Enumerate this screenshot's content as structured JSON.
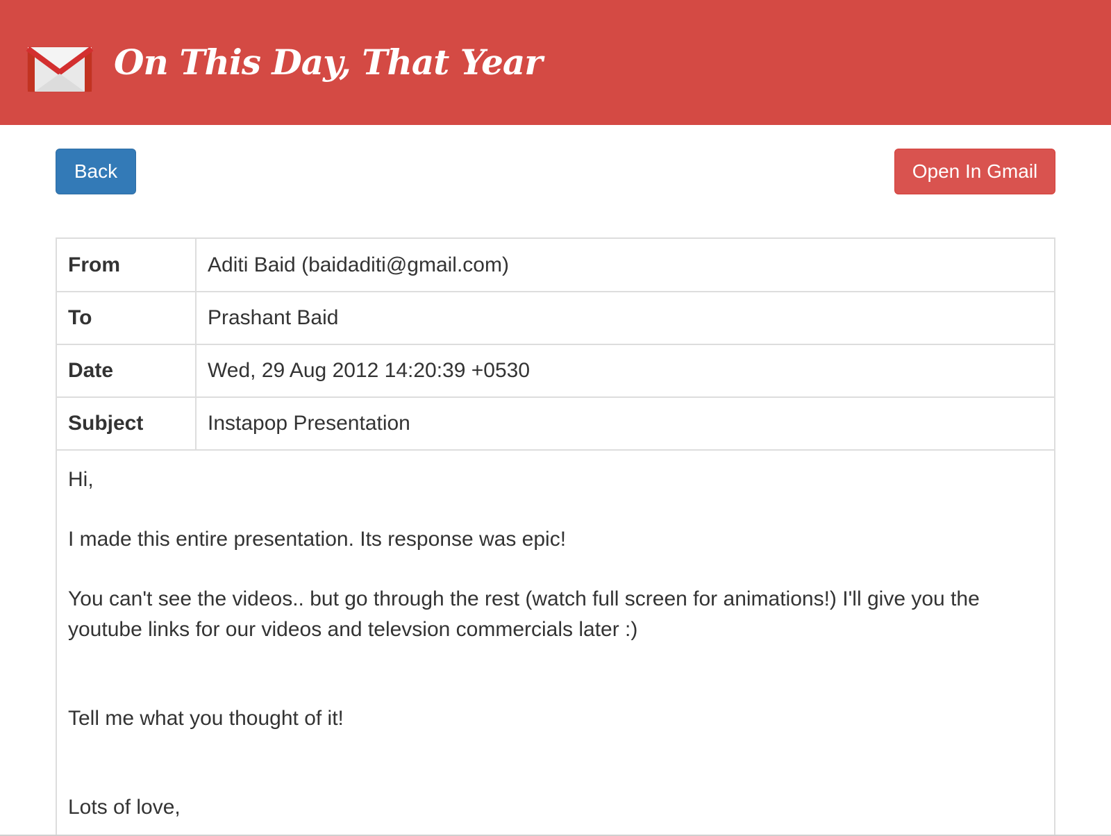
{
  "app": {
    "title": "On This Day, That Year",
    "logo_icon": "gmail-envelope-icon",
    "header_color": "#d44a44"
  },
  "actions": {
    "back_label": "Back",
    "open_gmail_label": "Open In Gmail"
  },
  "email": {
    "fields": [
      {
        "label": "From",
        "value": "Aditi Baid (baidaditi@gmail.com)"
      },
      {
        "label": "To",
        "value": "Prashant Baid"
      },
      {
        "label": "Date",
        "value": "Wed, 29 Aug 2012 14:20:39 +0530"
      },
      {
        "label": "Subject",
        "value": "Instapop Presentation"
      }
    ],
    "body": {
      "greeting": "Hi,",
      "para1": "I made this entire presentation. Its response was epic!",
      "para2": "You can't see the videos.. but go through the rest (watch full screen for animations!) I'll give you the youtube links for our videos and televsion commercials later :)",
      "para3": "Tell me what you thought of it!",
      "signoff": "Lots of love,"
    }
  }
}
